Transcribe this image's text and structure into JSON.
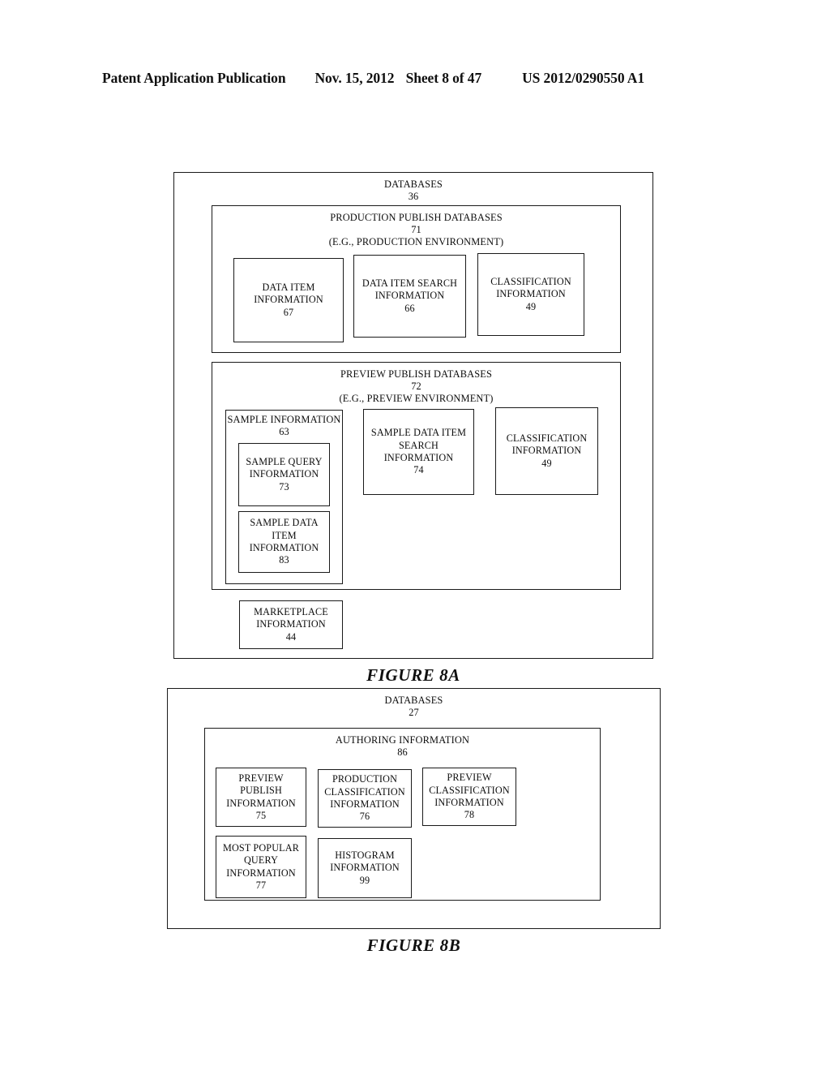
{
  "header": {
    "publication": "Patent Application Publication",
    "date": "Nov. 15, 2012",
    "sheet": "Sheet 8 of 47",
    "patent_number": "US 2012/0290550 A1"
  },
  "figure_8a": {
    "caption": "FIGURE 8A",
    "outer": {
      "title": "DATABASES",
      "number": "36"
    },
    "production": {
      "title": "PRODUCTION PUBLISH DATABASES",
      "number": "71",
      "subtitle": "(E.G., PRODUCTION ENVIRONMENT)",
      "boxes": [
        {
          "label": "DATA ITEM\nINFORMATION",
          "number": "67"
        },
        {
          "label": "DATA ITEM SEARCH\nINFORMATION",
          "number": "66"
        },
        {
          "label": "CLASSIFICATION\nINFORMATION",
          "number": "49"
        }
      ]
    },
    "preview": {
      "title": "PREVIEW PUBLISH DATABASES",
      "number": "72",
      "subtitle": "(E.G., PREVIEW ENVIRONMENT)",
      "sample_information": {
        "label": "SAMPLE INFORMATION",
        "number": "63"
      },
      "sample_children": [
        {
          "label": "SAMPLE QUERY\nINFORMATION",
          "number": "73"
        },
        {
          "label": "SAMPLE DATA\nITEM\nINFORMATION",
          "number": "83"
        }
      ],
      "boxes": [
        {
          "label": "SAMPLE DATA ITEM\nSEARCH\nINFORMATION",
          "number": "74"
        },
        {
          "label": "CLASSIFICATION\nINFORMATION",
          "number": "49"
        }
      ]
    },
    "marketplace": {
      "label": "MARKETPLACE\nINFORMATION",
      "number": "44"
    }
  },
  "figure_8b": {
    "caption": "FIGURE 8B",
    "outer": {
      "title": "DATABASES",
      "number": "27"
    },
    "authoring": {
      "title": "AUTHORING INFORMATION",
      "number": "86",
      "boxes": [
        {
          "label": "PREVIEW\nPUBLISH\nINFORMATION",
          "number": "75"
        },
        {
          "label": "PRODUCTION\nCLASSIFICATION\nINFORMATION",
          "number": "76"
        },
        {
          "label": "PREVIEW\nCLASSIFICATION\nINFORMATION",
          "number": "78"
        },
        {
          "label": "MOST POPULAR\nQUERY\nINFORMATION",
          "number": "77"
        },
        {
          "label": "HISTOGRAM\nINFORMATION",
          "number": "99"
        }
      ]
    }
  }
}
